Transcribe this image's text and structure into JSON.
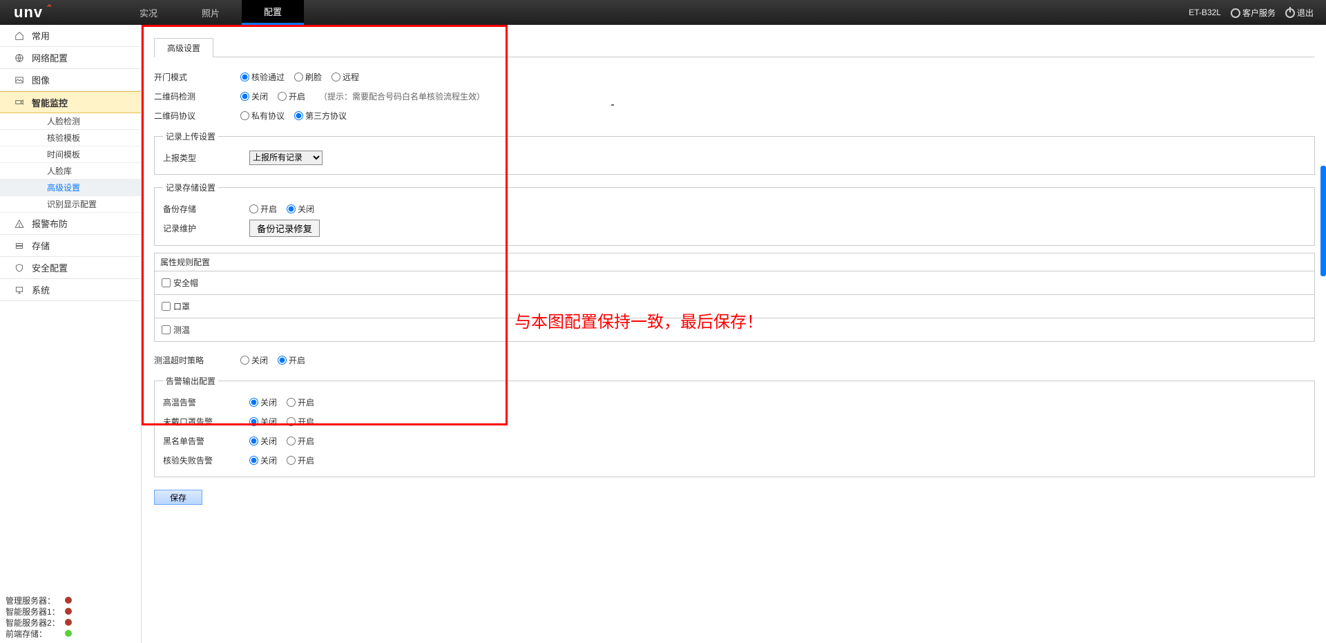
{
  "header": {
    "logo_text": "unv",
    "nav": {
      "live": "实况",
      "photo": "照片",
      "config": "配置"
    },
    "device": "ET-B32L",
    "service": "客户服务",
    "logout": "退出"
  },
  "sidebar": {
    "items": {
      "common": "常用",
      "network": "网络配置",
      "image": "图像",
      "smart": "智能监控",
      "alarm": "报警布防",
      "storage": "存储",
      "security": "安全配置",
      "system": "系统"
    },
    "smart_sub": {
      "face": "人脸检测",
      "verify": "核验模板",
      "time": "时间模板",
      "facelib": "人脸库",
      "advanced": "高级设置",
      "display": "识别显示配置"
    },
    "status": {
      "mgmt": "管理服务器：",
      "smart1": "智能服务器1：",
      "smart2": "智能服务器2：",
      "front": "前端存储："
    }
  },
  "tab": {
    "advanced": "高级设置"
  },
  "form": {
    "open_mode": {
      "label": "开门模式",
      "o1": "核验通过",
      "o2": "刷脸",
      "o3": "远程"
    },
    "qr_detect": {
      "label": "二维码检测",
      "off": "关闭",
      "on": "开启",
      "note": "（提示：需要配合号码白名单核验流程生效）"
    },
    "qr_protocol": {
      "label": "二维码协议",
      "p1": "私有协议",
      "p2": "第三方协议"
    },
    "upload_group": {
      "legend": "记录上传设置",
      "report_type": "上报类型",
      "report_opt": "上报所有记录"
    },
    "storage_group": {
      "legend": "记录存储设置",
      "backup": "备份存储",
      "on": "开启",
      "off": "关闭",
      "maintain": "记录维护",
      "repair_btn": "备份记录修复"
    },
    "attr_group": {
      "legend": "属性规则配置",
      "helmet": "安全帽",
      "mask": "口罩",
      "temp": "测温"
    },
    "temp_timeout": {
      "label": "测温超时策略",
      "off": "关闭",
      "on": "开启"
    },
    "alarm_group": {
      "legend": "告警输出配置",
      "rows": {
        "high_temp": "高温告警",
        "no_mask": "未戴口罩告警",
        "blacklist": "黑名单告警",
        "verify_fail": "核验失败告警"
      },
      "off": "关闭",
      "on": "开启"
    },
    "save": "保存"
  },
  "annotation": "与本图配置保持一致，最后保存！"
}
